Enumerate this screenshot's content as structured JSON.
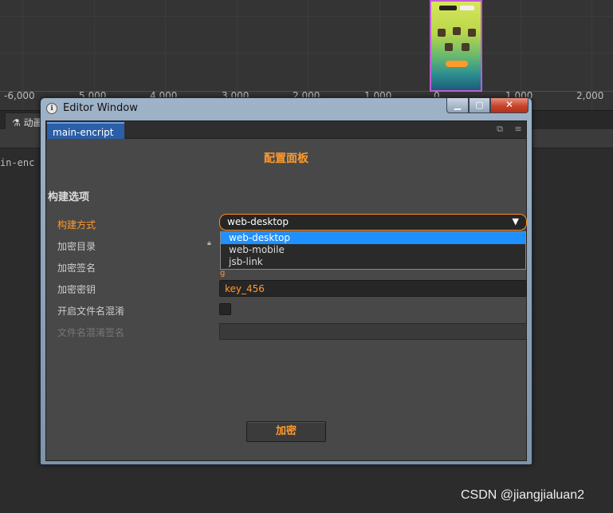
{
  "scene": {
    "ticks": [
      "-6,000",
      "5,000",
      "4,000",
      "3,000",
      "2,000",
      "1,000",
      "0",
      "1,000",
      "2,000"
    ]
  },
  "background_panel": {
    "tab_label": "动画",
    "code_fragment": "in-enc"
  },
  "window": {
    "title": "Editor Window",
    "controls": {
      "minimize": "▁",
      "maximize": "▢",
      "close": "✕"
    },
    "tab": {
      "label": "main-encript"
    },
    "panel_title": "配置面板",
    "section_title": "构建选项",
    "fields": {
      "build_mode": {
        "label": "构建方式",
        "selected": "web-desktop",
        "options": [
          "web-desktop",
          "web-mobile",
          "jsb-link"
        ]
      },
      "encrypt_dir": {
        "label": "加密目录"
      },
      "encrypt_sign": {
        "label": "加密签名",
        "value_fragment": "g"
      },
      "encrypt_key": {
        "label": "加密密钥",
        "value": "key_456"
      },
      "filename_obfuscate": {
        "label": "开启文件名混淆",
        "checked": false
      },
      "obfuscate_sign": {
        "label": "文件名混淆签名",
        "value": ""
      }
    },
    "encrypt_button": "加密"
  },
  "watermark": "CSDN @jiangjialuan2",
  "colors": {
    "accent": "#ff9a2c",
    "selection": "#1e90ff",
    "tab_active": "#2b5fa8"
  }
}
